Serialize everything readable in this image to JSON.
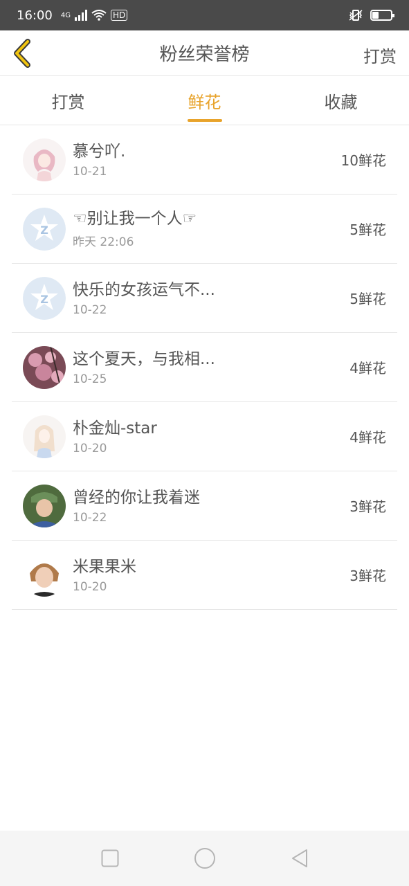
{
  "status_bar": {
    "time": "16:00",
    "network": "4G",
    "wifi": "HD",
    "battery_level": 0.35
  },
  "header": {
    "title": "粉丝荣誉榜",
    "action": "打赏"
  },
  "tabs": [
    {
      "label": "打赏",
      "active": false
    },
    {
      "label": "鲜花",
      "active": true
    },
    {
      "label": "收藏",
      "active": false
    }
  ],
  "rows": [
    {
      "name": "慕兮吖.",
      "date": "10-21",
      "count": "10鲜花",
      "avatar": "anime-girl-avatar"
    },
    {
      "name": "☜别让我一个人☞",
      "date": "昨天 22:06",
      "count": "5鲜花",
      "avatar": "default-qq-avatar"
    },
    {
      "name": "快乐的女孩运气不...",
      "date": "10-22",
      "count": "5鲜花",
      "avatar": "default-qq-avatar"
    },
    {
      "name": "这个夏天，与我相...",
      "date": "10-25",
      "count": "4鲜花",
      "avatar": "flower-avatar"
    },
    {
      "name": "朴金灿-star",
      "date": "10-20",
      "count": "4鲜花",
      "avatar": "anime-girl-avatar"
    },
    {
      "name": "曾经的你让我着迷",
      "date": "10-22",
      "count": "3鲜花",
      "avatar": "photo-avatar"
    },
    {
      "name": "米果果米",
      "date": "10-20",
      "count": "3鲜花",
      "avatar": "photo-avatar"
    }
  ],
  "colors": {
    "accent": "#e8a32b",
    "text": "#555555",
    "subtext": "#9a9a9a",
    "status_bg": "#4a4a4a"
  }
}
